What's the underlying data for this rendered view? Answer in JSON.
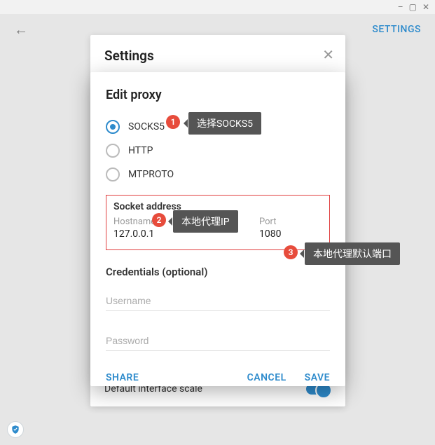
{
  "window": {
    "minimize": "–",
    "maximize": "▢",
    "close": "✕"
  },
  "header": {
    "settings_link": "SETTINGS"
  },
  "settings_panel": {
    "title": "Settings",
    "interface_scale_label": "Default interface scale"
  },
  "dialog": {
    "title": "Edit proxy",
    "radios": {
      "socks5": "SOCKS5",
      "http": "HTTP",
      "mtproto": "MTPROTO"
    },
    "socket_section": "Socket address",
    "hostname_label": "Hostname",
    "hostname_value": "127.0.0.1",
    "port_label": "Port",
    "port_value": "1080",
    "credentials_section": "Credentials (optional)",
    "username_placeholder": "Username",
    "password_placeholder": "Password",
    "share": "SHARE",
    "cancel": "CANCEL",
    "save": "SAVE"
  },
  "annotations": {
    "n1": "1",
    "tip1": "选择SOCKS5",
    "n2": "2",
    "tip2": "本地代理IP",
    "n3": "3",
    "tip3": "本地代理默认端口"
  }
}
